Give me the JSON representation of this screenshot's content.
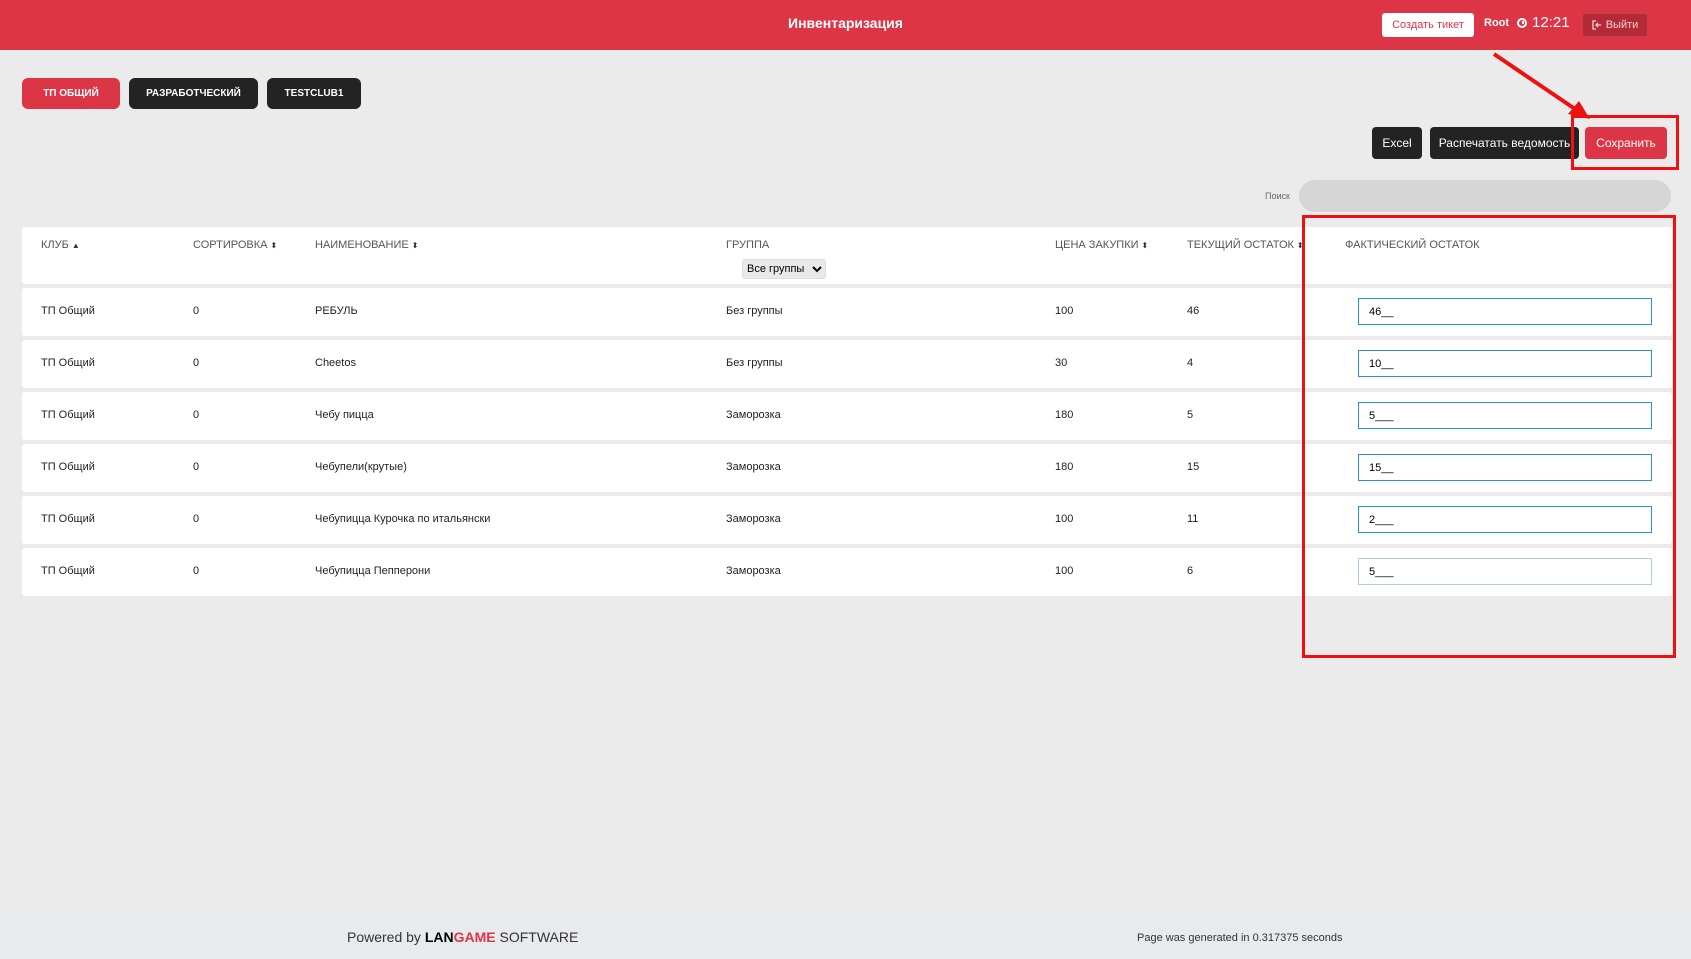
{
  "header": {
    "title": "Инвентаризация",
    "create_ticket": "Создать тикет",
    "user": "Root",
    "time": "12:21",
    "logout": "Выйти"
  },
  "tabs": [
    {
      "label": "ТП ОБЩИЙ",
      "active": true
    },
    {
      "label": "РАЗРАБОТЧЕСКИЙ",
      "active": false
    },
    {
      "label": "TESTCLUB1",
      "active": false
    }
  ],
  "actions": {
    "excel": "Excel",
    "print": "Распечатать ведомость",
    "save": "Сохранить"
  },
  "search": {
    "label": "Поиск",
    "value": ""
  },
  "table": {
    "columns": {
      "club": "КЛУБ",
      "sort": "СОРТИРОВКА",
      "name": "НАИМЕНОВАНИЕ",
      "group": "ГРУППА",
      "price": "ЦЕНА ЗАКУПКИ",
      "current": "ТЕКУЩИЙ ОСТАТОК",
      "actual": "ФАКТИЧЕСКИЙ ОСТАТОК"
    },
    "group_filter": "Все группы",
    "rows": [
      {
        "club": "ТП Общий",
        "sort": "0",
        "name": "РЕБУЛЬ",
        "group": "Без группы",
        "price": "100",
        "current": "46",
        "actual": "46__"
      },
      {
        "club": "ТП Общий",
        "sort": "0",
        "name": "Cheetos",
        "group": "Без группы",
        "price": "30",
        "current": "4",
        "actual": "10__"
      },
      {
        "club": "ТП Общий",
        "sort": "0",
        "name": "Чебу пицца",
        "group": "Заморозка",
        "price": "180",
        "current": "5",
        "actual": "5___"
      },
      {
        "club": "ТП Общий",
        "sort": "0",
        "name": "Чебупели(крутые)",
        "group": "Заморозка",
        "price": "180",
        "current": "15",
        "actual": "15__"
      },
      {
        "club": "ТП Общий",
        "sort": "0",
        "name": "Чебупицца Курочка по итальянски",
        "group": "Заморозка",
        "price": "100",
        "current": "11",
        "actual": "2___"
      },
      {
        "club": "ТП Общий",
        "sort": "0",
        "name": "Чебупицца Пепперони",
        "group": "Заморозка",
        "price": "100",
        "current": "6",
        "actual": "5___"
      }
    ]
  },
  "footer": {
    "powered_prefix": "Powered by ",
    "brand_lan": "LAN",
    "brand_game": "GAME",
    "brand_suffix": " SOFTWARE",
    "generated": "Page was generated in 0.317375 seconds"
  },
  "colors": {
    "brand": "#dc3545",
    "dark_button": "#232323",
    "annotation": "#ee1111"
  }
}
